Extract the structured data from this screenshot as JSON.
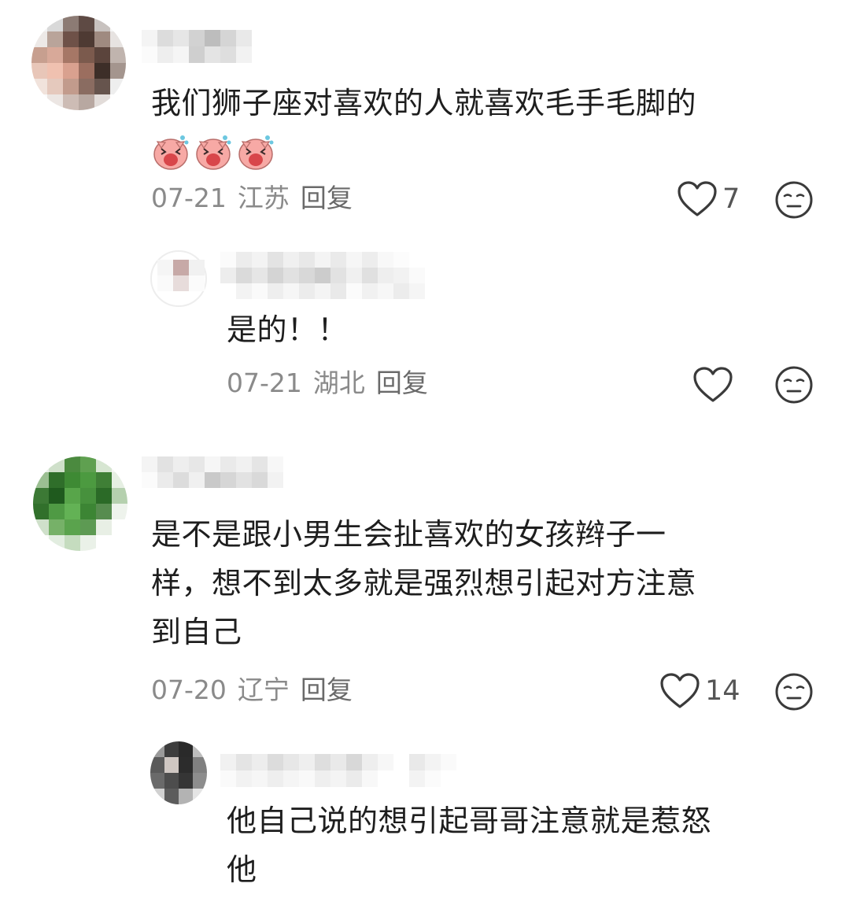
{
  "comments": [
    {
      "text_lines": [
        "我们狮子座对喜欢的人就喜欢毛手毛脚的"
      ],
      "emojis": [
        "laughing-pig-emoji",
        "laughing-pig-emoji",
        "laughing-pig-emoji"
      ],
      "date": "07-21",
      "location": "江苏",
      "reply_label": "回复",
      "likes": "7",
      "replies": [
        {
          "text_lines": [
            "是的！！"
          ],
          "date": "07-21",
          "location": "湖北",
          "reply_label": "回复",
          "likes": ""
        }
      ]
    },
    {
      "text_lines": [
        "是不是跟小男生会扯喜欢的女孩辫子一",
        "样，想不到太多就是强烈想引起对方注意",
        "到自己"
      ],
      "date": "07-20",
      "location": "辽宁",
      "reply_label": "回复",
      "likes": "14",
      "replies": [
        {
          "text_lines": [
            "他自己说的想引起哥哥注意就是惹怒",
            "他"
          ]
        }
      ]
    }
  ],
  "icons": {
    "like": "heart-outline-icon",
    "dislike": "meh-face-icon"
  },
  "colors": {
    "text": "#1e1e1e",
    "meta": "#8a8a8a",
    "icon": "#3a3a3a"
  }
}
